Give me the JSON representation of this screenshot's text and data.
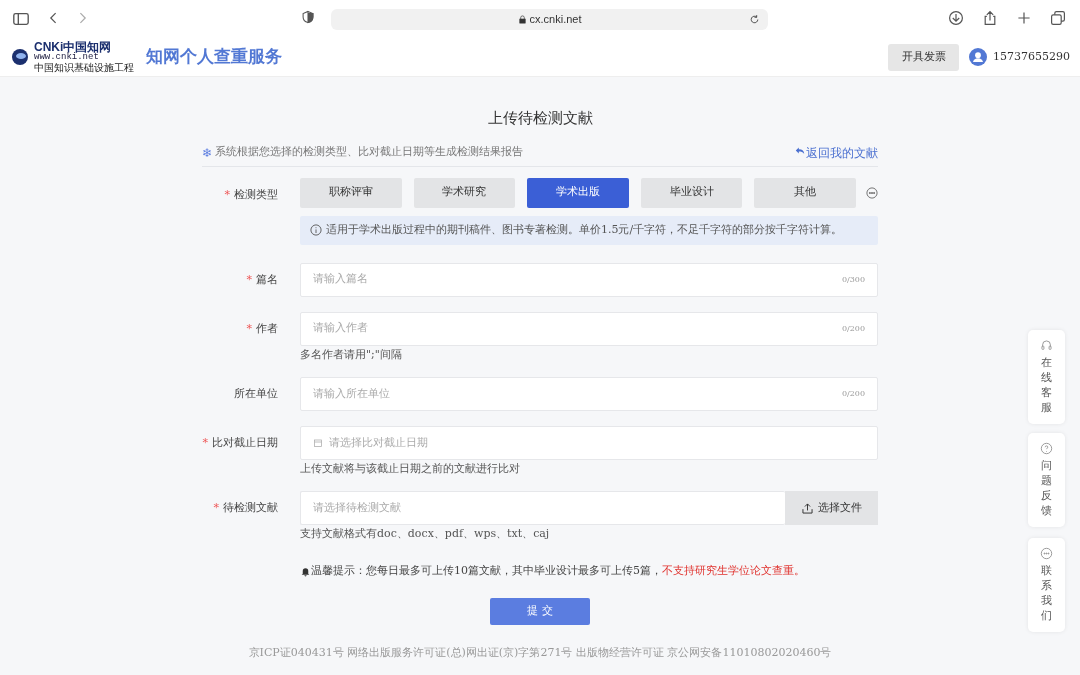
{
  "browser": {
    "url": "cx.cnki.net"
  },
  "header": {
    "logo": {
      "name": "CNKi中国知网",
      "url": "www.cnki.net",
      "tagline": "中国知识基础设施工程"
    },
    "title": "知网个人查重服务",
    "invoice_button": "开具发票",
    "user": "15737655290"
  },
  "page_title": "上传待检测文献",
  "intro": {
    "icon": "❄",
    "text": "系统根据您选择的检测类型、比对截止日期等生成检测结果报告",
    "back_link": "返回我的文献"
  },
  "type_field": {
    "label": "检测类型",
    "required_mark": "*",
    "types": [
      {
        "label": "职称评审",
        "selected": false
      },
      {
        "label": "学术研究",
        "selected": false
      },
      {
        "label": "学术出版",
        "selected": true
      },
      {
        "label": "毕业设计",
        "selected": false
      },
      {
        "label": "其他",
        "selected": false
      }
    ],
    "info": "适用于学术出版过程中的期刊稿件、图书专著检测。单价1.5元/千字符，不足千字符的部分按千字符计算。"
  },
  "fields": [
    {
      "kind": "text",
      "label": "篇名",
      "required_mark": "*",
      "placeholder": "请输入篇名",
      "counter": "0/300"
    },
    {
      "kind": "text",
      "label": "作者",
      "required_mark": "*",
      "placeholder": "请输入作者",
      "counter": "0/200",
      "hint": "多名作者请用\";\"间隔"
    },
    {
      "kind": "text",
      "label": "所在单位",
      "placeholder": "请输入所在单位",
      "counter": "0/200"
    },
    {
      "kind": "date",
      "label": "比对截止日期",
      "required_mark": "*",
      "placeholder": "请选择比对截止日期",
      "hint": "上传文献将与该截止日期之前的文献进行比对"
    },
    {
      "kind": "file",
      "label": "待检测文献",
      "required_mark": "*",
      "placeholder": "请选择待检测文献",
      "button": "选择文件",
      "hint": "支持文献格式有doc、docx、pdf、wps、txt、caj"
    }
  ],
  "notice": {
    "text": "温馨提示：您每日最多可上传10篇文献，其中毕业设计最多可上传5篇，",
    "warning": "不支持研究生学位论文查重。"
  },
  "submit": "提 交",
  "footer": [
    "京ICP证040431号 网络出版服务许可证(总)网出证(京)字第271号 出版物经营许可证 京公网安备11010802020460号"
  ],
  "side_buttons": [
    {
      "kind": "headset",
      "text": "在线客服"
    },
    {
      "kind": "question",
      "text": "问题反馈"
    },
    {
      "kind": "chat",
      "text": "联系我们"
    }
  ]
}
